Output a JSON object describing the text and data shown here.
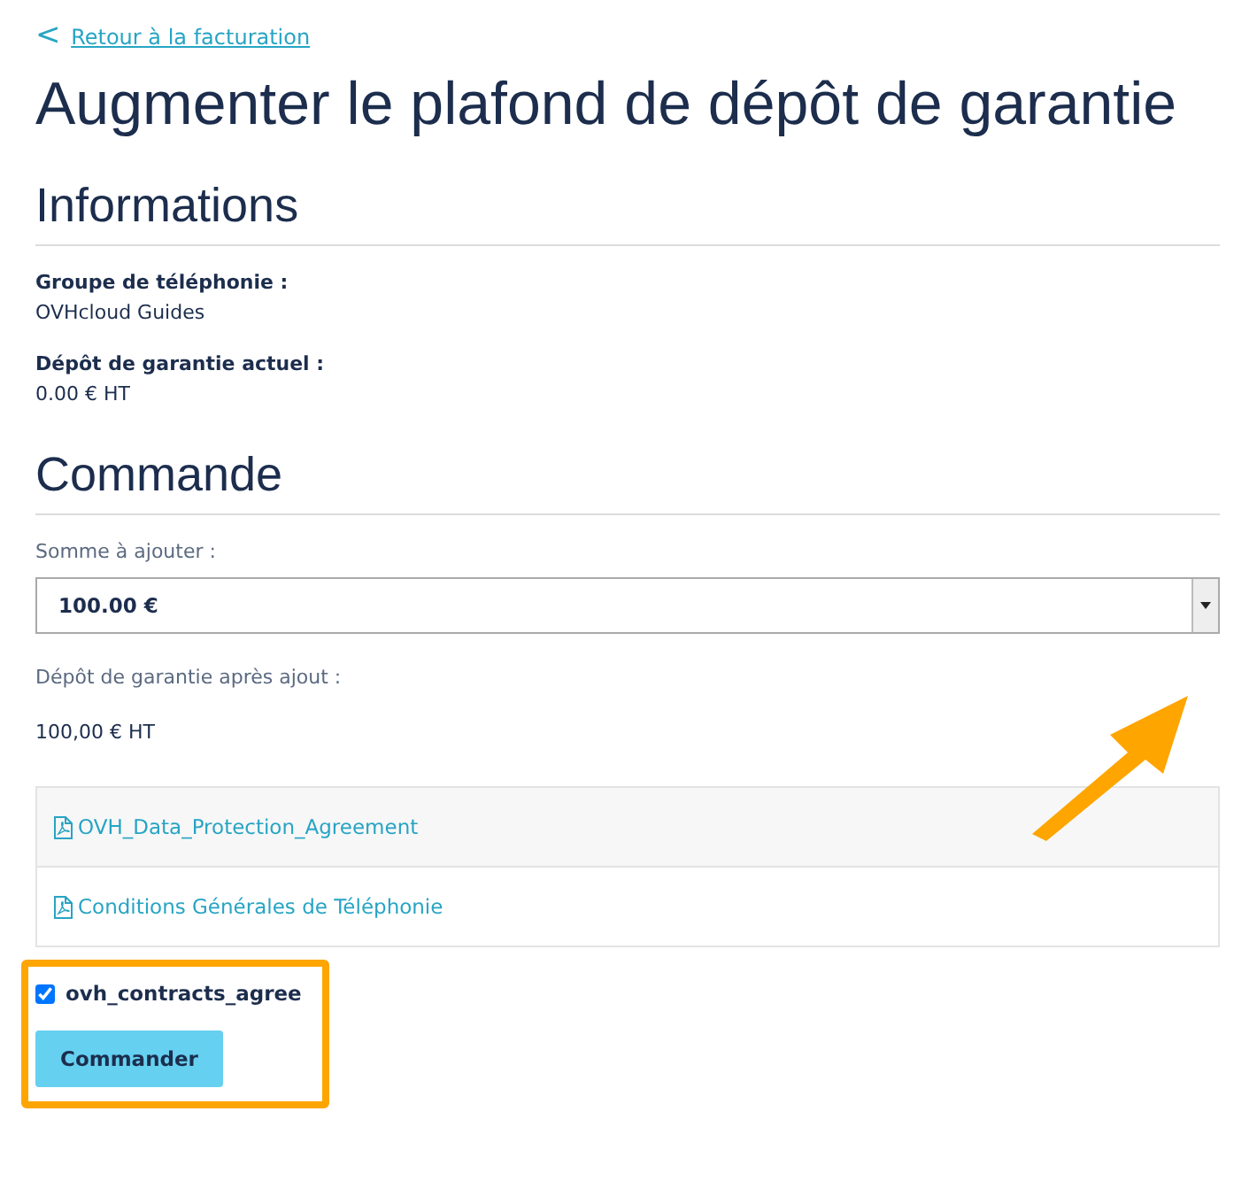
{
  "back_link": {
    "icon": "<",
    "label": "Retour à la facturation"
  },
  "title": "Augmenter le plafond de dépôt de garantie",
  "informations": {
    "heading": "Informations",
    "fields": [
      {
        "label": "Groupe de téléphonie :",
        "value": "OVHcloud Guides"
      },
      {
        "label": "Dépôt de garantie actuel :",
        "value": "0.00 €   HT"
      }
    ]
  },
  "commande": {
    "heading": "Commande",
    "amount_label": "Somme à ajouter :",
    "amount_value": "100.00 €",
    "after_label": "Dépôt de garantie après ajout :",
    "after_value": "100,00 €   HT"
  },
  "documents": [
    {
      "label": "OVH_Data_Protection_Agreement"
    },
    {
      "label": "Conditions Générales de Téléphonie"
    }
  ],
  "agree": {
    "label": "ovh_contracts_agree",
    "checked": true
  },
  "submit": "Commander"
}
